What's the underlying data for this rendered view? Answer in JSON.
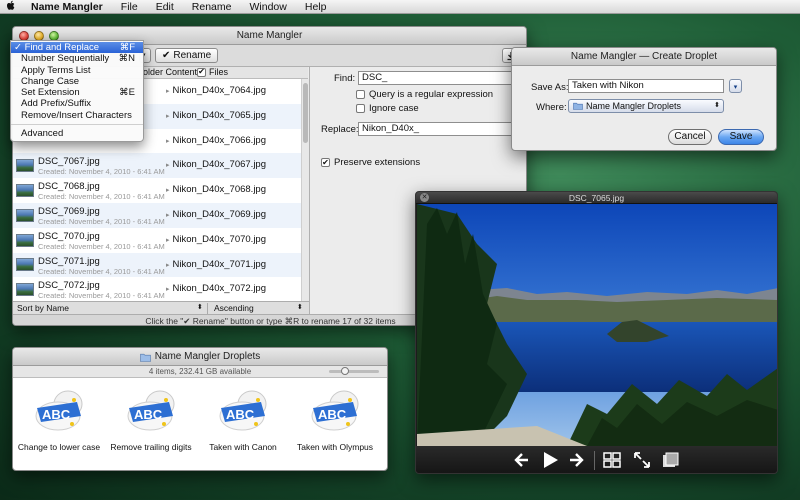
{
  "menubar": {
    "app_name": "Name Mangler",
    "items": [
      "File",
      "Edit",
      "Rename",
      "Window",
      "Help"
    ]
  },
  "main_window": {
    "title": "Name Mangler",
    "rename_button": "Rename",
    "folder_contents_label": "older Contents",
    "files_label": "Files",
    "method_menu": [
      {
        "label": "Find and Replace",
        "shortcut": "⌘F",
        "selected": true
      },
      {
        "label": "Number Sequentially",
        "shortcut": "⌘N"
      },
      {
        "label": "Apply Terms List",
        "shortcut": ""
      },
      {
        "label": "Change Case",
        "shortcut": ""
      },
      {
        "label": "Set Extension",
        "shortcut": "⌘E"
      },
      {
        "label": "Add Prefix/Suffix",
        "shortcut": ""
      },
      {
        "label": "Remove/Insert Characters",
        "shortcut": ""
      },
      {
        "label": "Advanced",
        "shortcut": "",
        "separator_before": true
      }
    ],
    "files": [
      {
        "name": "",
        "date": "",
        "new_name": "Nikon_D40x_7064.jpg"
      },
      {
        "name": "",
        "date": "",
        "new_name": "Nikon_D40x_7065.jpg"
      },
      {
        "name": "",
        "date": "",
        "new_name": "Nikon_D40x_7066.jpg"
      },
      {
        "name": "DSC_7067.jpg",
        "date": "Created: November 4, 2010 - 6:41 AM",
        "new_name": "Nikon_D40x_7067.jpg"
      },
      {
        "name": "DSC_7068.jpg",
        "date": "Created: November 4, 2010 - 6:41 AM",
        "new_name": "Nikon_D40x_7068.jpg"
      },
      {
        "name": "DSC_7069.jpg",
        "date": "Created: November 4, 2010 - 6:41 AM",
        "new_name": "Nikon_D40x_7069.jpg"
      },
      {
        "name": "DSC_7070.jpg",
        "date": "Created: November 4, 2010 - 6:41 AM",
        "new_name": "Nikon_D40x_7070.jpg"
      },
      {
        "name": "DSC_7071.jpg",
        "date": "Created: November 4, 2010 - 6:41 AM",
        "new_name": "Nikon_D40x_7071.jpg"
      },
      {
        "name": "DSC_7072.jpg",
        "date": "Created: November 4, 2010 - 6:41 AM",
        "new_name": "Nikon_D40x_7072.jpg"
      }
    ],
    "sort_by": "Sort by Name",
    "sort_order": "Ascending",
    "status_text": "Click the \"✔ Rename\" button or type ⌘R to rename 17 of 32 items",
    "find_label": "Find:",
    "find_value": "DSC_",
    "regex_label": "Query is a regular expression",
    "ignore_case_label": "Ignore case",
    "replace_label": "Replace:",
    "replace_value": "Nikon_D40x_",
    "preserve_label": "Preserve extensions"
  },
  "droplet_sheet": {
    "title": "Name Mangler — Create Droplet",
    "save_as_label": "Save As:",
    "save_as_value": "Taken with Nikon",
    "where_label": "Where:",
    "where_value": "Name Mangler Droplets",
    "cancel_label": "Cancel",
    "save_label": "Save"
  },
  "droplets_window": {
    "title": "Name Mangler Droplets",
    "info": "4 items, 232.41 GB available",
    "items": [
      {
        "label": "Change to lower case"
      },
      {
        "label": "Remove trailing digits"
      },
      {
        "label": "Taken with Canon"
      },
      {
        "label": "Taken with Olympus"
      }
    ]
  },
  "viewer_window": {
    "title": "DSC_7065.jpg"
  },
  "colors": {
    "selection_blue": "#2a62d6",
    "desktop_green": "#1f5e37"
  }
}
